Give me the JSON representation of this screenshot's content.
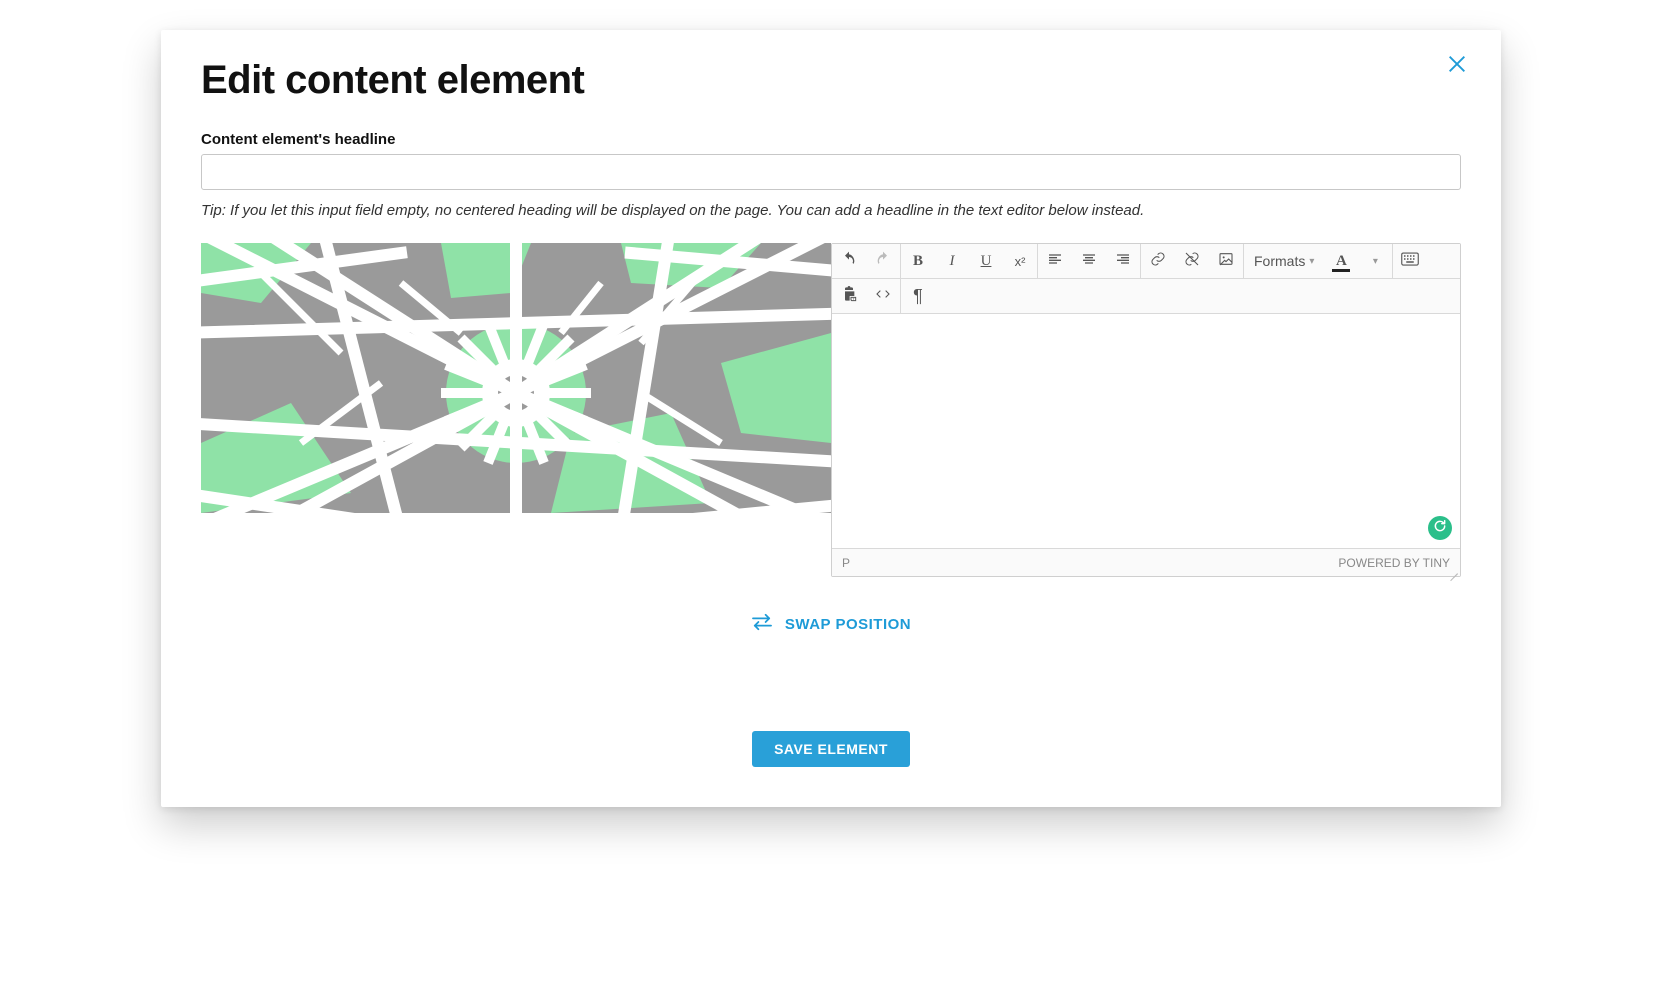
{
  "modal": {
    "title": "Edit content element",
    "headline_label": "Content element's headline",
    "headline_value": "",
    "tip": "Tip: If you let this input field empty, no centered heading will be displayed on the page. You can add a headline in the text editor below instead."
  },
  "editor": {
    "formats_label": "Formats",
    "path": "P",
    "powered_by": "POWERED BY TINY"
  },
  "actions": {
    "swap_label": "SWAP POSITION",
    "save_label": "SAVE ELEMENT"
  },
  "colors": {
    "accent": "#1e9bd7",
    "save_bg": "#29a0d8"
  }
}
